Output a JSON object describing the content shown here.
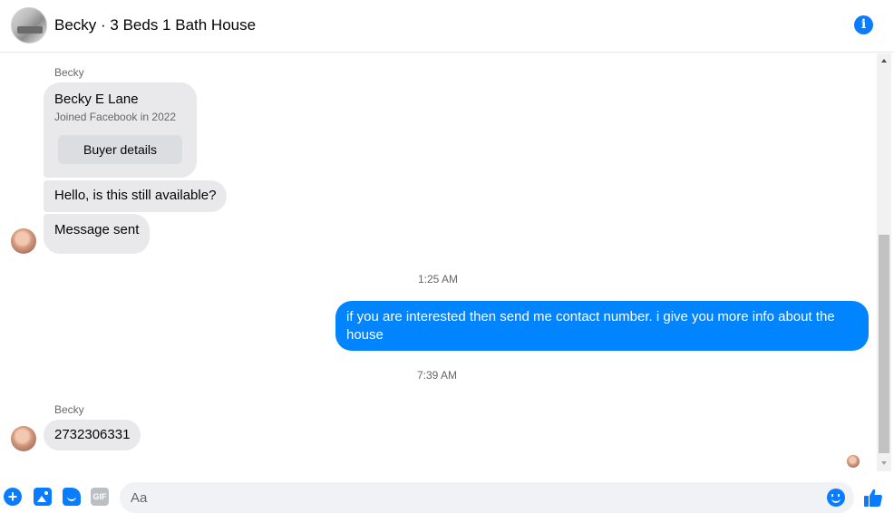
{
  "header": {
    "title": "Becky · 3 Beds 1 Bath House",
    "info_icon": "info-icon"
  },
  "thread": {
    "sender_label_1": "Becky",
    "profile_card": {
      "name": "Becky E Lane",
      "joined": "Joined Facebook in 2022",
      "button_label": "Buyer details"
    },
    "message_available": "Hello, is this still available?",
    "message_sent": "Message sent",
    "timestamp_1": "1:25 AM",
    "my_message": "if you are interested then send me contact number. i give you more info about the house",
    "timestamp_2": "7:39 AM",
    "sender_label_2": "Becky",
    "message_number": "2732306331"
  },
  "composer": {
    "placeholder": "Aa",
    "gif_label": "GIF",
    "plus_label": "+"
  },
  "colors": {
    "accent": "#0a7cff",
    "my_bubble": "#0084ff",
    "their_bubble": "#e9e9eb"
  }
}
